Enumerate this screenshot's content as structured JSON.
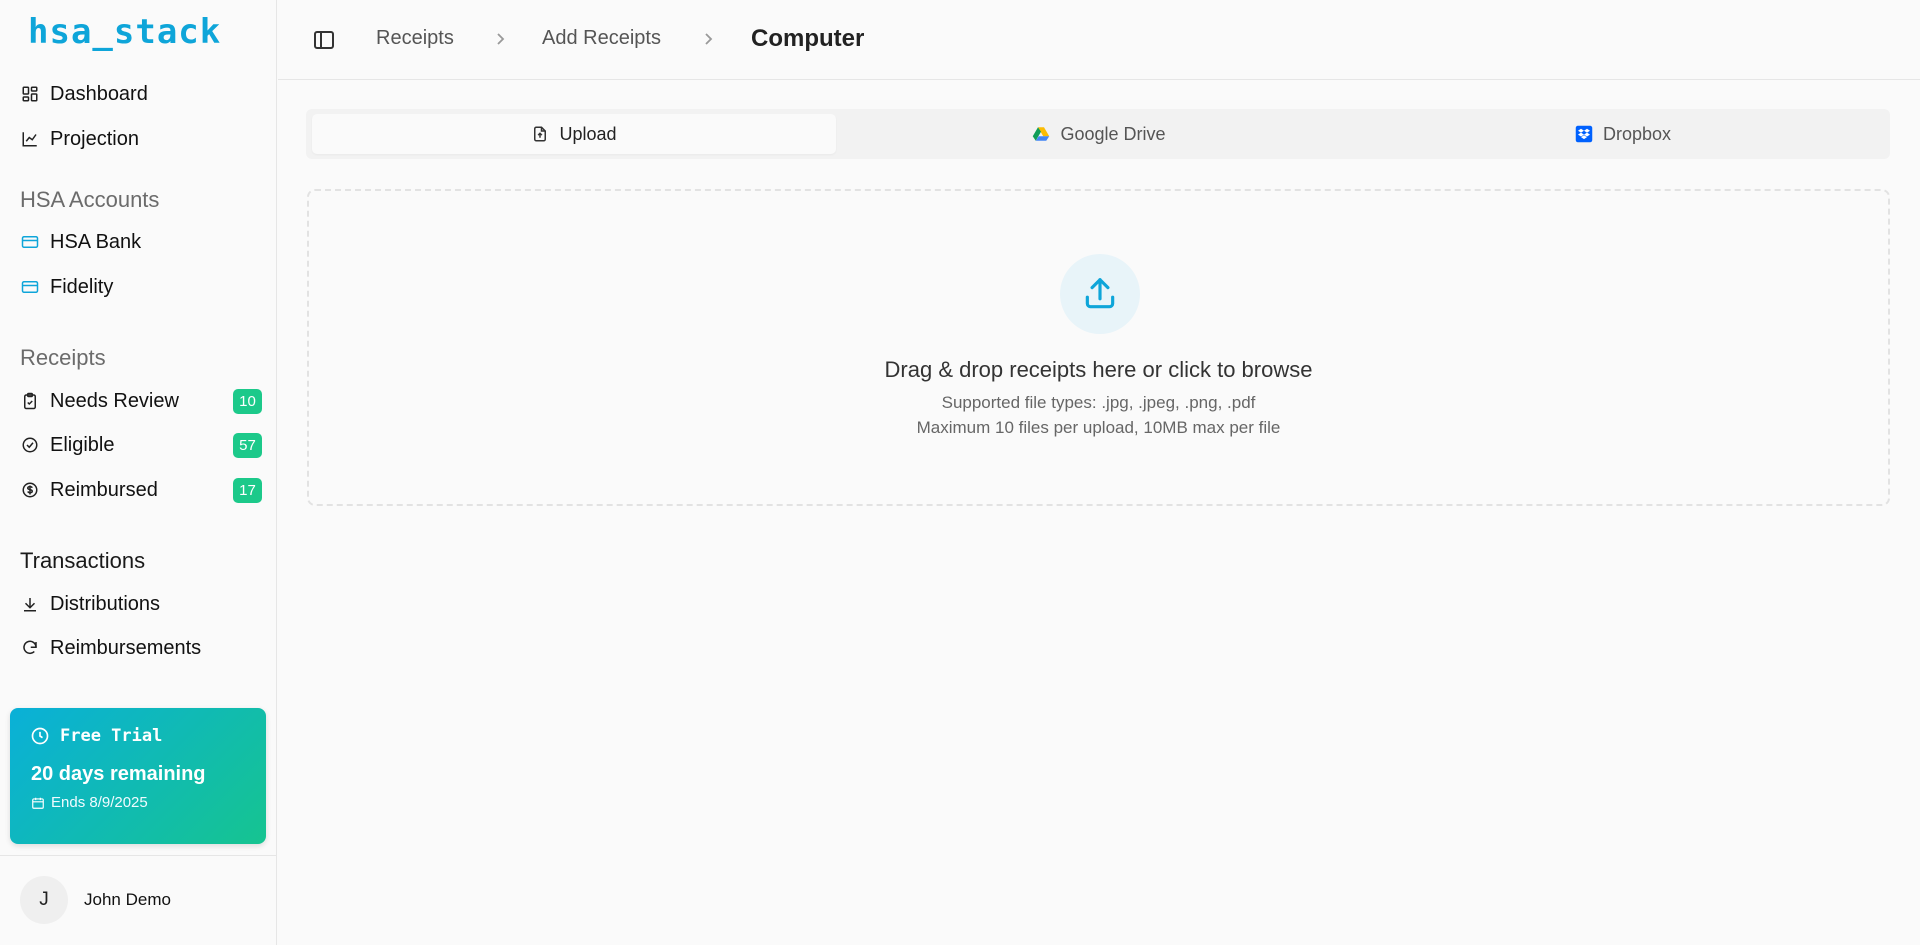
{
  "app": {
    "logo": "hsa_stack"
  },
  "sidebar": {
    "main_items": [
      {
        "label": "Dashboard",
        "icon": "dashboard-icon"
      },
      {
        "label": "Projection",
        "icon": "chart-line-icon"
      }
    ],
    "accounts_label": "HSA Accounts",
    "accounts": [
      {
        "label": "HSA Bank",
        "icon": "credit-card-icon"
      },
      {
        "label": "Fidelity",
        "icon": "credit-card-icon"
      }
    ],
    "receipts_label": "Receipts",
    "receipts": [
      {
        "label": "Needs Review",
        "count": "10",
        "icon": "clipboard-check-icon"
      },
      {
        "label": "Eligible",
        "count": "57",
        "icon": "check-circle-icon"
      },
      {
        "label": "Reimbursed",
        "count": "17",
        "icon": "dollar-circle-icon"
      }
    ],
    "transactions_label": "Transactions",
    "transactions": [
      {
        "label": "Distributions",
        "icon": "download-icon"
      },
      {
        "label": "Reimbursements",
        "icon": "refresh-icon"
      }
    ],
    "trial": {
      "title": "Free Trial",
      "days": "20 days remaining",
      "ends": "Ends 8/9/2025"
    },
    "user": {
      "initial": "J",
      "name": "John Demo"
    }
  },
  "header": {
    "breadcrumbs": [
      "Receipts",
      "Add Receipts"
    ],
    "current": "Computer"
  },
  "tabs": [
    {
      "label": "Upload",
      "icon": "file-upload-icon",
      "active": true
    },
    {
      "label": "Google Drive",
      "icon": "google-drive-icon",
      "active": false
    },
    {
      "label": "Dropbox",
      "icon": "dropbox-icon",
      "active": false
    }
  ],
  "dropzone": {
    "title": "Drag & drop receipts here or click to browse",
    "types": "Supported file types: .jpg, .jpeg, .png, .pdf",
    "limits": "Maximum 10 files per upload, 10MB max per file"
  },
  "colors": {
    "brand": "#0ea5d9",
    "badge": "#1cc98a",
    "trial_gradient_start": "#0ab0d8",
    "trial_gradient_end": "#16c490"
  }
}
